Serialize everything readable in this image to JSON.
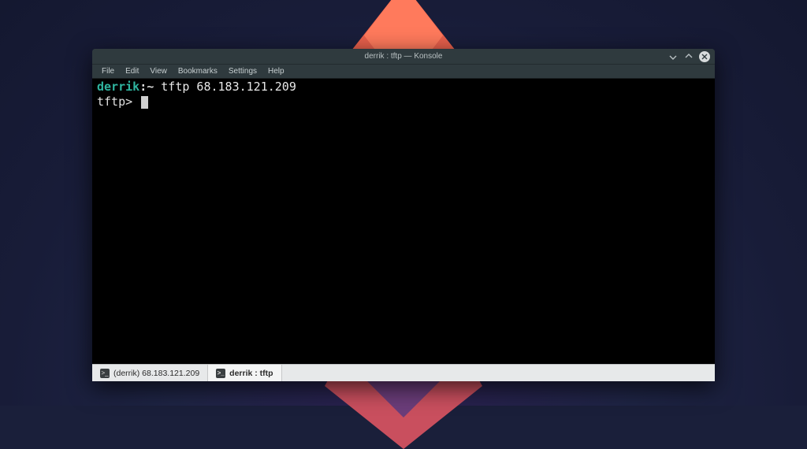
{
  "window": {
    "title": "derrik : tftp — Konsole"
  },
  "menubar": {
    "items": [
      "File",
      "Edit",
      "View",
      "Bookmarks",
      "Settings",
      "Help"
    ]
  },
  "terminal": {
    "prompt_user": "derrik",
    "prompt_colon": ":",
    "prompt_path": "~",
    "command": "tftp 68.183.121.209",
    "tftp_prompt": "tftp>"
  },
  "tabs": [
    {
      "label": "(derrik) 68.183.121.209",
      "active": false
    },
    {
      "label": "derrik : tftp",
      "active": true
    }
  ]
}
